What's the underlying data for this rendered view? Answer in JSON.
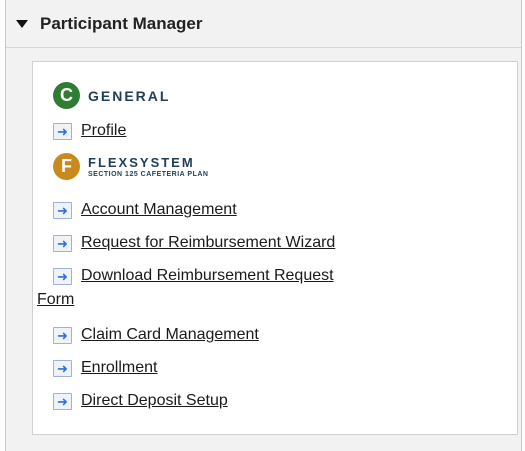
{
  "header": {
    "title": "Participant Manager"
  },
  "brands": {
    "general": {
      "name": "GENERAL",
      "logo_char": "C",
      "color": "#2e7d32"
    },
    "flexsystem": {
      "name": "FLEXSYSTEM",
      "subtitle": "SECTION 125 CAFETERIA PLAN",
      "logo_char": "F",
      "color": "#c88a1e"
    }
  },
  "links": {
    "profile": "Profile",
    "account_management": "Account Management",
    "request_wizard": "Request for Reimbursement Wizard",
    "download_form": "Download Reimbursement Request Form",
    "claim_card": "Claim Card Management",
    "enrollment": "Enrollment",
    "direct_deposit": "Direct Deposit Setup"
  },
  "icons": {
    "link_arrow": "arrow-right-icon"
  }
}
